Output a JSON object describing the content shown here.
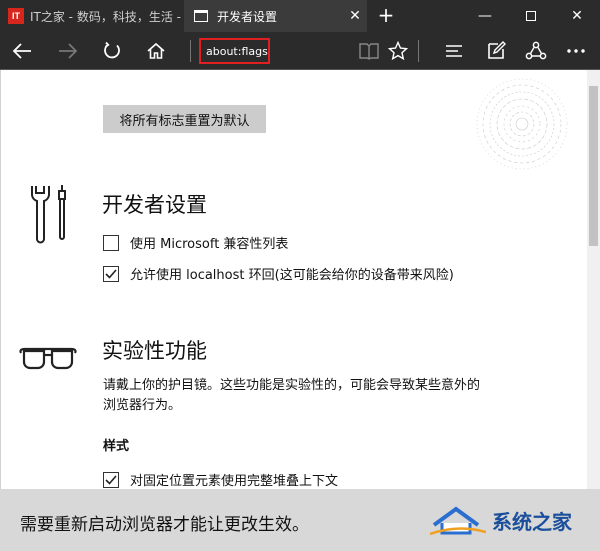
{
  "tabs": [
    {
      "title": "IT之家 - 数码，科技，生活 -",
      "icon": "it-logo-icon",
      "favicon_text": "IT",
      "active": false
    },
    {
      "title": "开发者设置",
      "icon": "page-icon",
      "active": true
    }
  ],
  "tab_close_glyph": "✕",
  "new_tab_glyph": "+",
  "window_controls": {
    "minimize": "—",
    "close": "✕"
  },
  "address": {
    "value": "about:flags",
    "highlight_color": "#e02020"
  },
  "reset_button": "将所有标志重置为默认",
  "developer_section": {
    "title": "开发者设置",
    "options": [
      {
        "label": "使用 Microsoft 兼容性列表",
        "checked": false
      },
      {
        "label": "允许使用 localhost 环回(这可能会给你的设备带来风险)",
        "checked": true
      }
    ]
  },
  "experimental_section": {
    "title": "实验性功能",
    "description": "请戴上你的护目镜。这些功能是实验性的，可能会导致某些意外的浏览器行为。",
    "subheading": "样式",
    "options": [
      {
        "label": "对固定位置元素使用完整堆叠上下文",
        "checked": true
      }
    ]
  },
  "notice": "需要重新启动浏览器才能让更改生效。",
  "watermark": "系统之家",
  "colors": {
    "chrome": "#2b2b2b",
    "notice_bg": "#d8d8d8",
    "button_bg": "#cccccc",
    "watermark": "#1b4f9b"
  }
}
